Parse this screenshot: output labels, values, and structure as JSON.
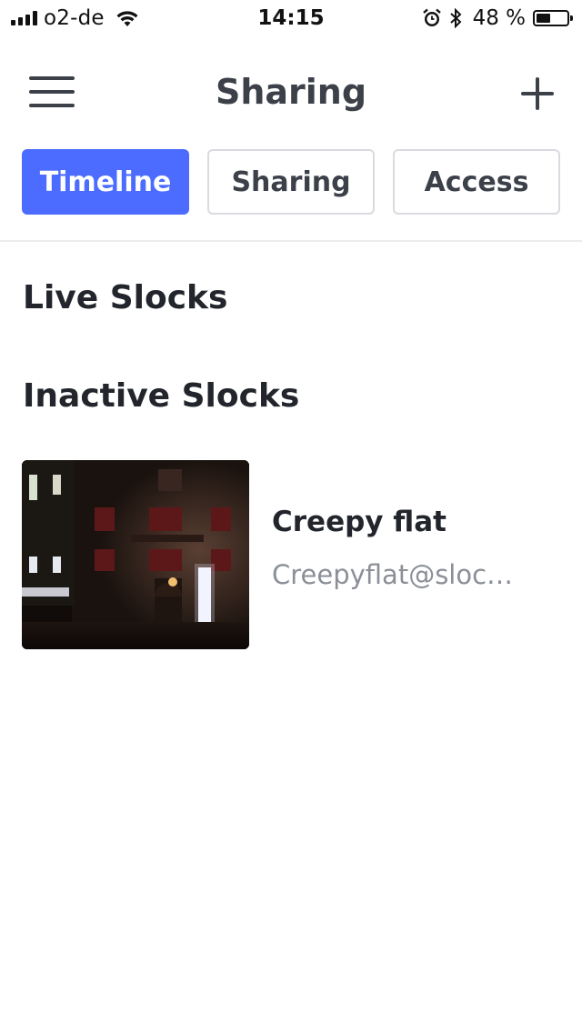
{
  "status_bar": {
    "carrier": "o2-de",
    "time": "14:15",
    "battery_percent": "48 %",
    "battery_level": 0.48,
    "icons": [
      "signal-icon",
      "wifi-icon",
      "alarm-icon",
      "bluetooth-icon",
      "battery-icon"
    ]
  },
  "header": {
    "title": "Sharing",
    "menu_icon": "hamburger-menu-icon",
    "add_icon": "plus-icon"
  },
  "tabs": [
    {
      "label": "Timeline",
      "active": true
    },
    {
      "label": "Sharing",
      "active": false
    },
    {
      "label": "Access",
      "active": false
    }
  ],
  "sections": {
    "live": {
      "title": "Live Slocks"
    },
    "inactive": {
      "title": "Inactive Slocks",
      "items": [
        {
          "name": "Creepy flat",
          "email": "Creepyflat@sloc…"
        }
      ]
    }
  },
  "colors": {
    "accent": "#4b6cff",
    "text_dark": "#22252b",
    "text_header": "#3c4049",
    "text_muted": "#8b8f97",
    "tab_border": "#d9dbe0"
  }
}
